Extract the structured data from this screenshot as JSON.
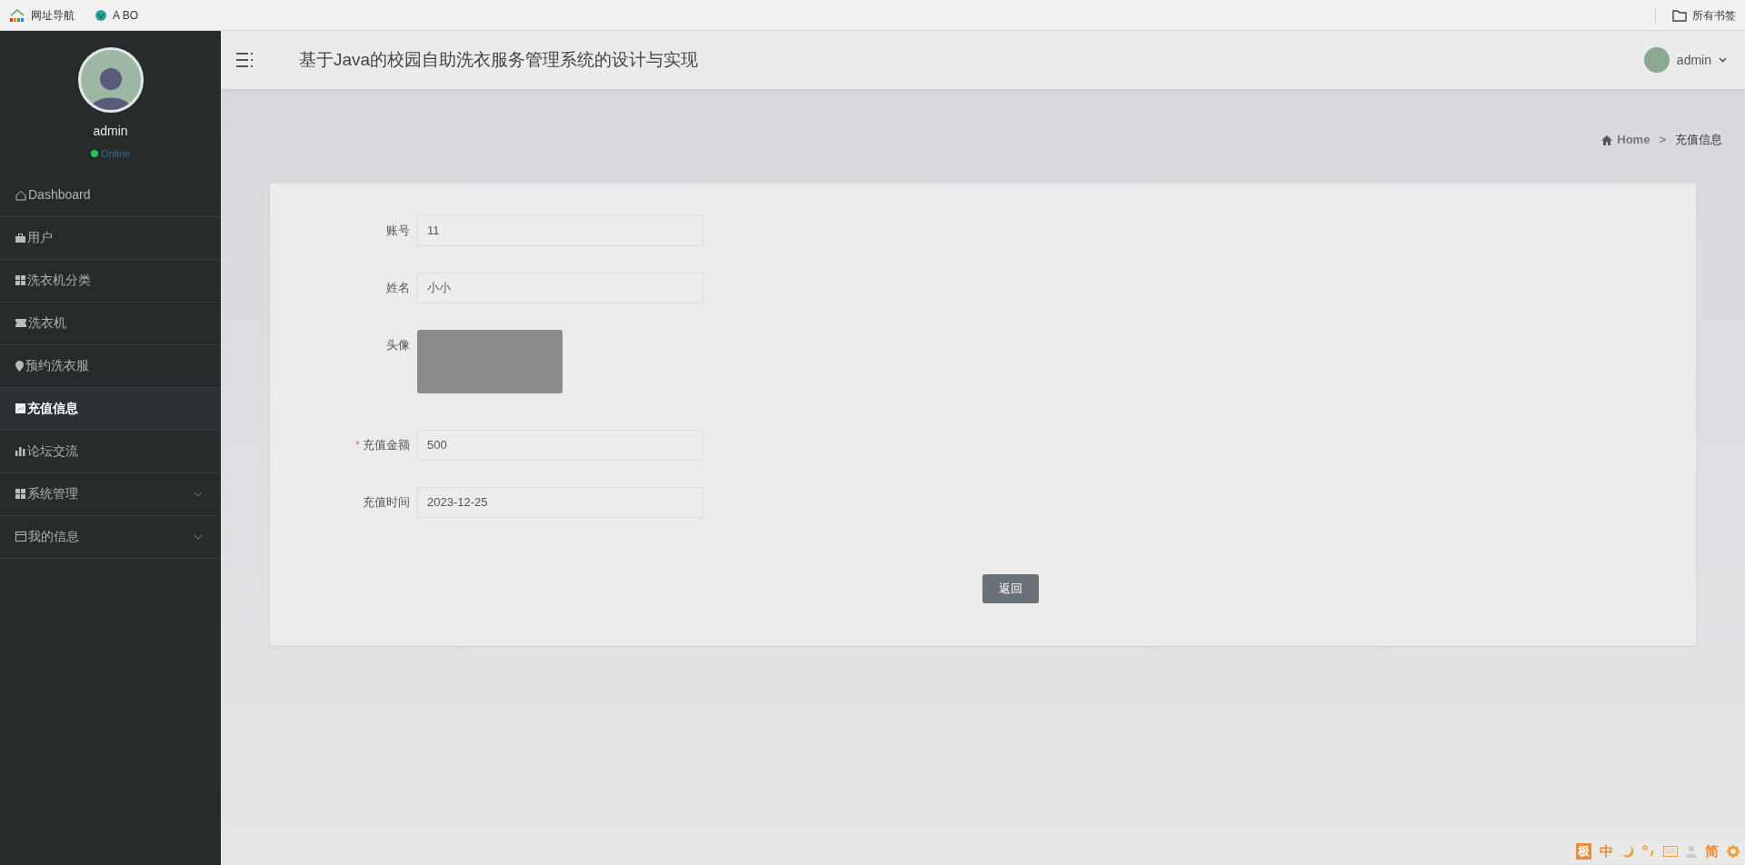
{
  "bookmarks_bar": {
    "items": [
      {
        "label": "网址导航"
      },
      {
        "label": "A BO"
      }
    ],
    "all_bookmarks": "所有书签"
  },
  "sidebar": {
    "user": {
      "name": "admin",
      "status": "Online",
      "status_dot": {
        "color": "#22c55e"
      }
    },
    "items": [
      {
        "label": "Dashboard",
        "selected": false
      },
      {
        "label": "用户",
        "selected": false
      },
      {
        "label": "洗衣机分类",
        "selected": false
      },
      {
        "label": "洗衣机",
        "selected": false
      },
      {
        "label": "预约洗衣服",
        "selected": false
      },
      {
        "label": "充值信息",
        "selected": true
      },
      {
        "label": "论坛交流",
        "selected": false
      },
      {
        "label": "系统管理",
        "selected": false,
        "expanded": false
      },
      {
        "label": "我的信息",
        "selected": false,
        "expanded": false
      }
    ]
  },
  "header": {
    "title": "基于Java的校园自助洗衣服务管理系统的设计与实现",
    "user": "admin"
  },
  "breadcrumb": [
    {
      "kind": "link",
      "label": "Home"
    },
    {
      "kind": "separator",
      "label": ">"
    },
    {
      "kind": "current",
      "label": "充值信息"
    }
  ],
  "form": {
    "fields": [
      {
        "kind": "text",
        "label": "账号",
        "value": "11"
      },
      {
        "kind": "text",
        "label": "姓名",
        "value": "小小"
      },
      {
        "kind": "image",
        "label": "头像"
      },
      {
        "kind": "text",
        "label": "充值金额",
        "value": "500",
        "required_mark": "*"
      },
      {
        "kind": "text",
        "label": "充值时间",
        "value": "2023-12-25"
      }
    ],
    "buttons": [
      "返回"
    ]
  },
  "ime_toolbar": {
    "items": [
      {
        "kind": "badge",
        "text": "极"
      },
      {
        "kind": "text",
        "text": "中"
      },
      {
        "kind": "moon"
      },
      {
        "kind": "punctuation"
      },
      {
        "kind": "keyboard"
      },
      {
        "kind": "user"
      },
      {
        "kind": "text",
        "text": "简"
      },
      {
        "kind": "gear"
      }
    ]
  }
}
